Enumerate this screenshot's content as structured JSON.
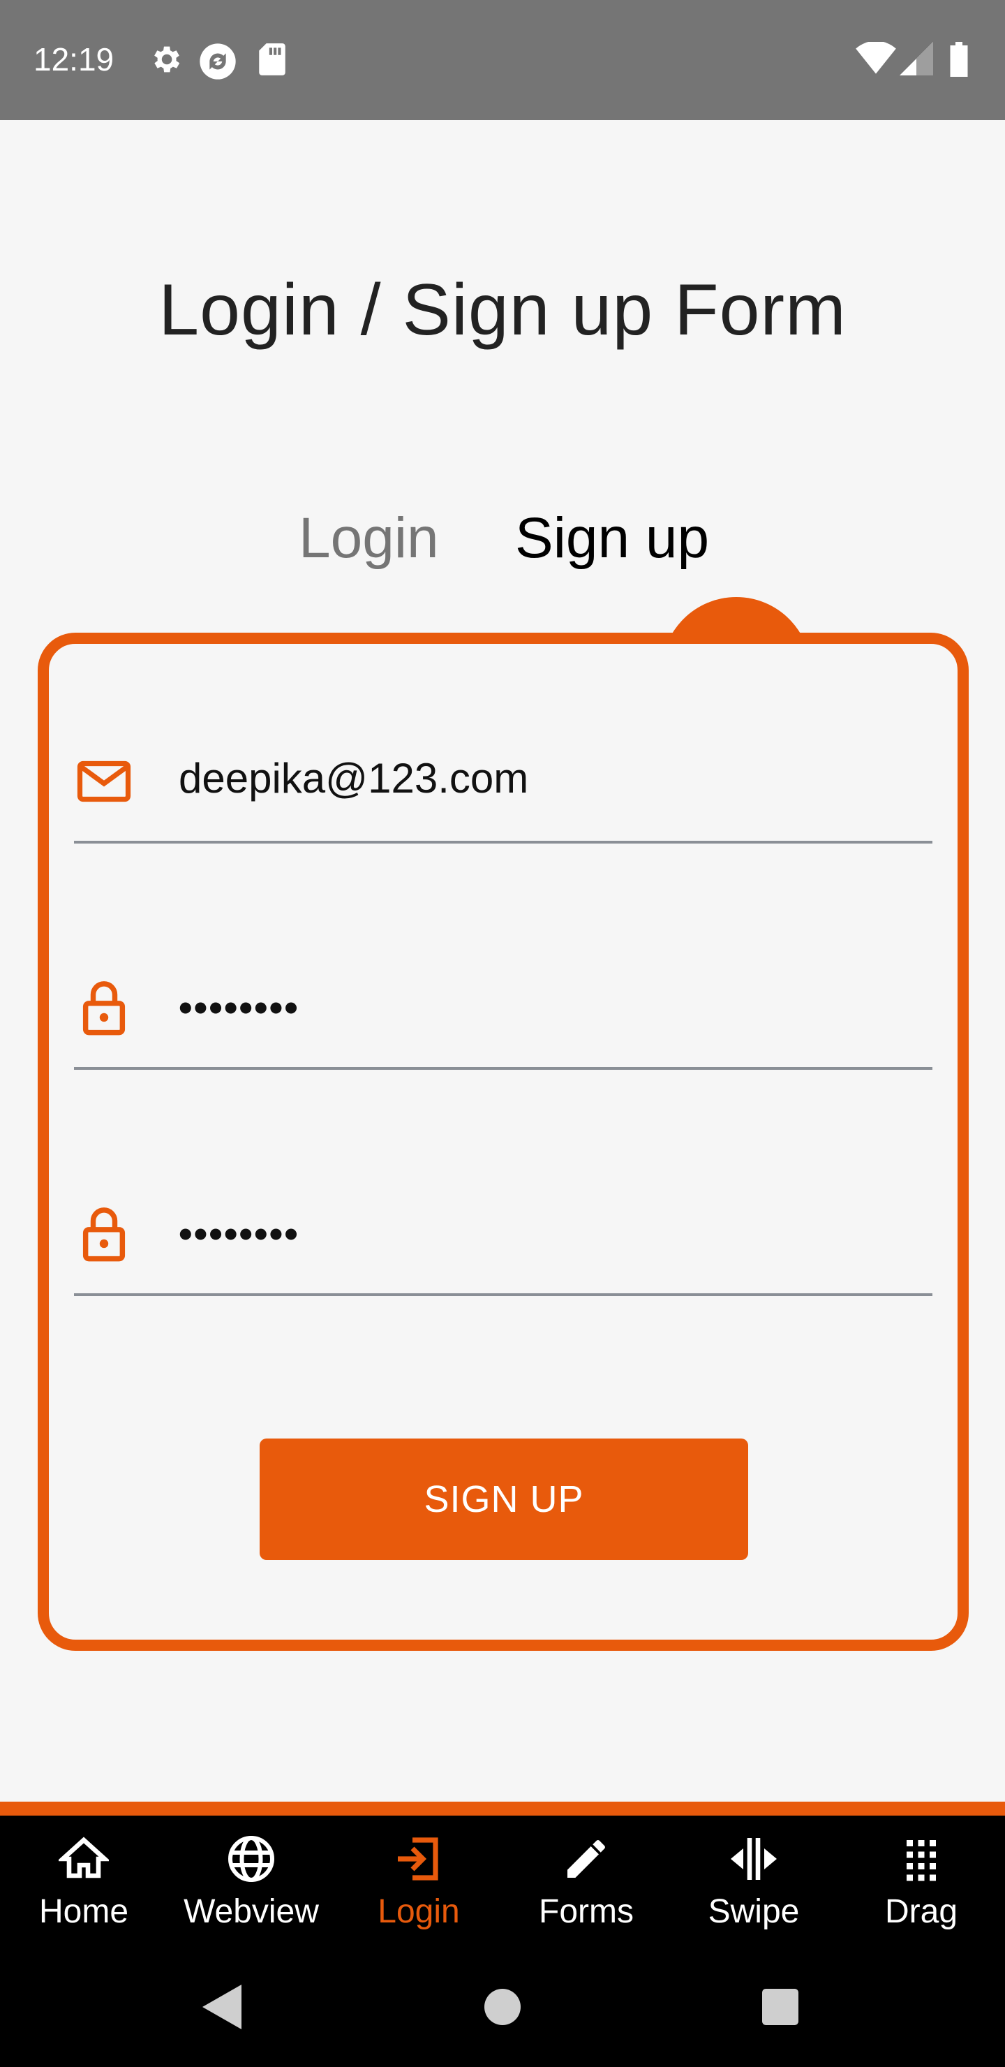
{
  "status_bar": {
    "time": "12:19",
    "icons": [
      "settings-icon",
      "sync-icon",
      "sd-card-icon",
      "wifi-icon",
      "signal-icon",
      "battery-icon"
    ]
  },
  "page": {
    "title": "Login / Sign up Form"
  },
  "tabs": [
    {
      "label": "Login",
      "active": false
    },
    {
      "label": "Sign up",
      "active": true
    }
  ],
  "form": {
    "email_value": "deepika@123.com",
    "password_value": "••••••••",
    "confirm_password_value": "••••••••",
    "submit_label": "SIGN UP"
  },
  "bottom_nav": [
    {
      "label": "Home",
      "icon": "home-icon",
      "active": false
    },
    {
      "label": "Webview",
      "icon": "globe-icon",
      "active": false
    },
    {
      "label": "Login",
      "icon": "login-icon",
      "active": true
    },
    {
      "label": "Forms",
      "icon": "pencil-icon",
      "active": false
    },
    {
      "label": "Swipe",
      "icon": "swipe-icon",
      "active": false
    },
    {
      "label": "Drag",
      "icon": "drag-grid-icon",
      "active": false
    }
  ],
  "colors": {
    "accent": "#e85a0c",
    "status_bar": "#757575",
    "background": "#f6f6f6",
    "nav_background": "#000000"
  }
}
